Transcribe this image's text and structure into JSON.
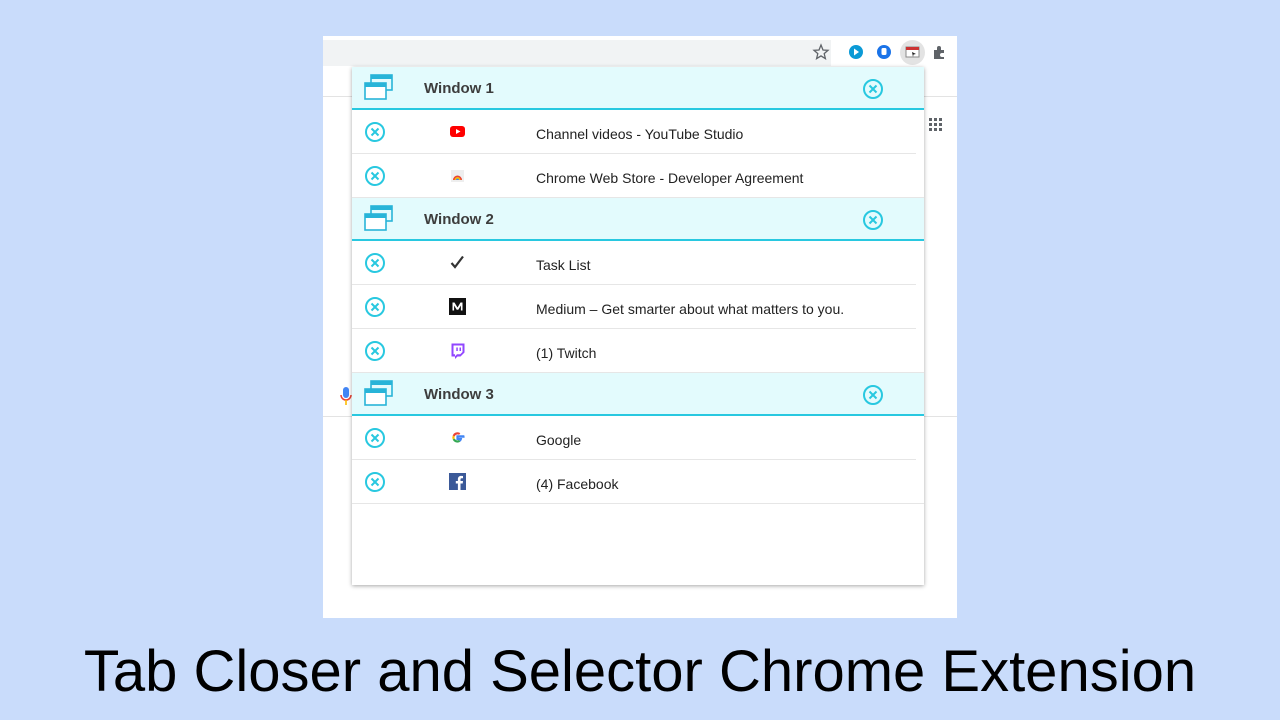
{
  "popup": {
    "windows": [
      {
        "title": "Window 1",
        "tabs": [
          {
            "title": "Channel videos - YouTube Studio",
            "favicon": "youtube-icon"
          },
          {
            "title": "Chrome Web Store - Developer Agreement",
            "favicon": "chrome-web-store-icon"
          }
        ]
      },
      {
        "title": "Window 2",
        "tabs": [
          {
            "title": "Task List",
            "favicon": "checkmark-icon"
          },
          {
            "title": "Medium – Get smarter about what matters to you.",
            "favicon": "medium-icon"
          },
          {
            "title": "(1) Twitch",
            "favicon": "twitch-icon"
          }
        ]
      },
      {
        "title": "Window 3",
        "tabs": [
          {
            "title": "Google",
            "favicon": "google-icon"
          },
          {
            "title": "(4) Facebook",
            "favicon": "facebook-icon"
          }
        ]
      }
    ]
  },
  "caption": "Tab Closer and Selector Chrome Extension",
  "colors": {
    "background": "#c9dcfb",
    "accent": "#28c8e0",
    "header_bg": "#e3fbfd"
  }
}
